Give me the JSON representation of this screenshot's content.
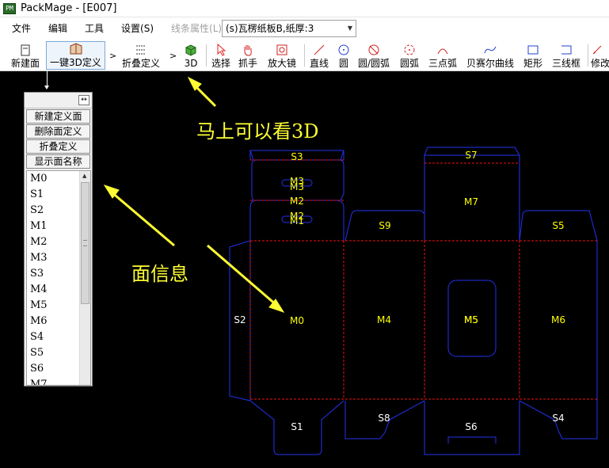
{
  "window": {
    "title": "PackMage - [E007]",
    "icon_text": "PM"
  },
  "menu": {
    "items": [
      "文件",
      "编辑",
      "工具",
      "设置(S)"
    ],
    "disabled_item": "线条属性(L)",
    "material_select": "(s)瓦楞纸板B,纸厚:3"
  },
  "toolbar": {
    "new_face": "新建面",
    "one_key_3d": "一键3D定义",
    "fold_def": "折叠定义",
    "view_3d": "3D",
    "select": "选择",
    "grab": "抓手",
    "magnifier": "放大镜",
    "line": "直线",
    "circle": "圆",
    "circle_arc": "圆/圆弧",
    "arc": "圆弧",
    "three_point_arc": "三点弧",
    "bezier": "贝赛尔曲线",
    "rect": "矩形",
    "three_line_box": "三线框",
    "modify": "修改",
    "arrow1": ">",
    "arrow2": ">"
  },
  "face_panel": {
    "pin": "↔",
    "buttons": [
      "新建定义面",
      "删除面定义",
      "折叠定义",
      "显示面名称"
    ],
    "items": [
      "M0",
      "S1",
      "S2",
      "M1",
      "M2",
      "M3",
      "S3",
      "M4",
      "M5",
      "M6",
      "S4",
      "S5",
      "S6",
      "M7"
    ]
  },
  "annotations": {
    "see_3d": "马上可以看3D",
    "face_info": "面信息"
  },
  "canvas": {
    "labels": [
      "S3",
      "M3",
      "M3",
      "M2",
      "M1",
      "M2",
      "S7",
      "M7",
      "S9",
      "S5",
      "S2",
      "M0",
      "M4",
      "M5",
      "M5",
      "M6",
      "S1",
      "S8",
      "S6",
      "S4"
    ]
  },
  "colors": {
    "cut_line": "#2233ee",
    "fold_line": "#ee1111",
    "label": "#ffff00",
    "annotation": "#ffff33",
    "background": "#000000"
  }
}
